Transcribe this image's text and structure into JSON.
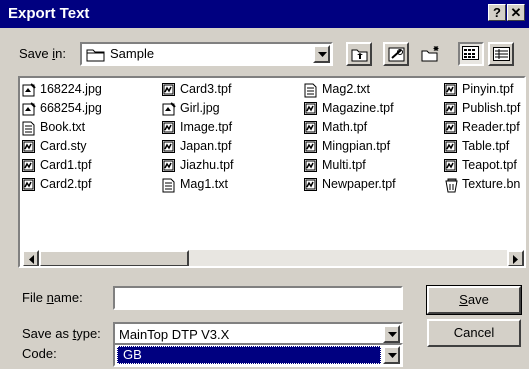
{
  "window": {
    "title": "Export Text",
    "help_label": "?",
    "close_label": "✕"
  },
  "save_in": {
    "label_pre": "Save ",
    "label_accel": "i",
    "label_post": "n:",
    "folder": "Sample"
  },
  "files": [
    {
      "name": "168224.jpg",
      "icon": "image-file-icon"
    },
    {
      "name": "668254.jpg",
      "icon": "image-file-icon"
    },
    {
      "name": "Book.txt",
      "icon": "text-file-icon"
    },
    {
      "name": "Card.sty",
      "icon": "template-file-icon"
    },
    {
      "name": "Card1.tpf",
      "icon": "template-file-icon"
    },
    {
      "name": "Card2.tpf",
      "icon": "template-file-icon"
    },
    {
      "name": "Card3.tpf",
      "icon": "template-file-icon"
    },
    {
      "name": "Girl.jpg",
      "icon": "image-file-icon"
    },
    {
      "name": "Image.tpf",
      "icon": "template-file-icon"
    },
    {
      "name": "Japan.tpf",
      "icon": "template-file-icon"
    },
    {
      "name": "Jiazhu.tpf",
      "icon": "template-file-icon"
    },
    {
      "name": "Mag1.txt",
      "icon": "text-file-icon"
    },
    {
      "name": "Mag2.txt",
      "icon": "text-file-icon"
    },
    {
      "name": "Magazine.tpf",
      "icon": "template-file-icon"
    },
    {
      "name": "Math.tpf",
      "icon": "template-file-icon"
    },
    {
      "name": "Mingpian.tpf",
      "icon": "template-file-icon"
    },
    {
      "name": "Multi.tpf",
      "icon": "template-file-icon"
    },
    {
      "name": "Newpaper.tpf",
      "icon": "template-file-icon"
    },
    {
      "name": "Pinyin.tpf",
      "icon": "template-file-icon"
    },
    {
      "name": "Publish.tpf",
      "icon": "template-file-icon"
    },
    {
      "name": "Reader.tpf",
      "icon": "template-file-icon"
    },
    {
      "name": "Table.tpf",
      "icon": "template-file-icon"
    },
    {
      "name": "Teapot.tpf",
      "icon": "template-file-icon"
    },
    {
      "name": "Texture.bn",
      "icon": "bin-file-icon"
    }
  ],
  "file_name": {
    "label_pre": "File ",
    "label_accel": "n",
    "label_post": "ame:",
    "value": ""
  },
  "save_as_type": {
    "label_pre": "Save as ",
    "label_accel": "t",
    "label_post": "ype:",
    "value": "MainTop DTP V3.X"
  },
  "code": {
    "label": "Code:",
    "value": "GB"
  },
  "buttons": {
    "save_accel": "S",
    "save_rest": "ave",
    "cancel": "Cancel"
  },
  "colors": {
    "title_bar": "#000080",
    "face": "#d4d0c8",
    "highlight": "#000080"
  }
}
